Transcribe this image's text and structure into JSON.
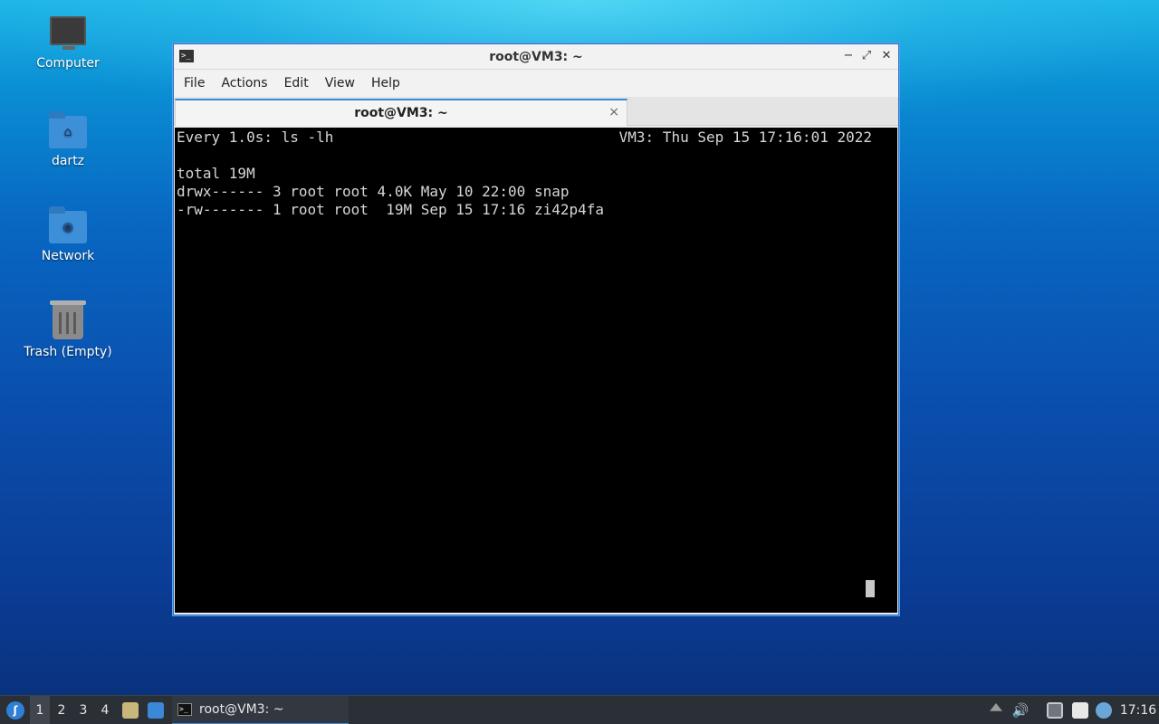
{
  "desktop": {
    "icons": [
      {
        "label": "Computer",
        "icon": "computer-icon"
      },
      {
        "label": "dartz",
        "icon": "home-folder-icon"
      },
      {
        "label": "Network",
        "icon": "network-folder-icon"
      },
      {
        "label": "Trash (Empty)",
        "icon": "trash-icon"
      }
    ]
  },
  "window": {
    "title": "root@VM3: ~",
    "controls": {
      "minimize": "−",
      "maximize": "⤢",
      "close": "✕"
    },
    "menu": [
      "File",
      "Actions",
      "Edit",
      "View",
      "Help"
    ],
    "tab": {
      "label": "root@VM3: ~",
      "close": "×"
    }
  },
  "terminal": {
    "header_left": "Every 1.0s: ls -lh",
    "header_right": "VM3: Thu Sep 15 17:16:01 2022",
    "lines": [
      "",
      "total 19M",
      "drwx------ 3 root root 4.0K May 10 22:00 snap",
      "-rw------- 1 root root  19M Sep 15 17:16 zi42p4fa"
    ]
  },
  "taskbar": {
    "workspaces": [
      "1",
      "2",
      "3",
      "4"
    ],
    "active_workspace": "1",
    "task_label": "root@VM3: ~",
    "clock": "17:16",
    "colors": {
      "accent": "#3b88d8",
      "bar": "#2b2f36"
    }
  }
}
